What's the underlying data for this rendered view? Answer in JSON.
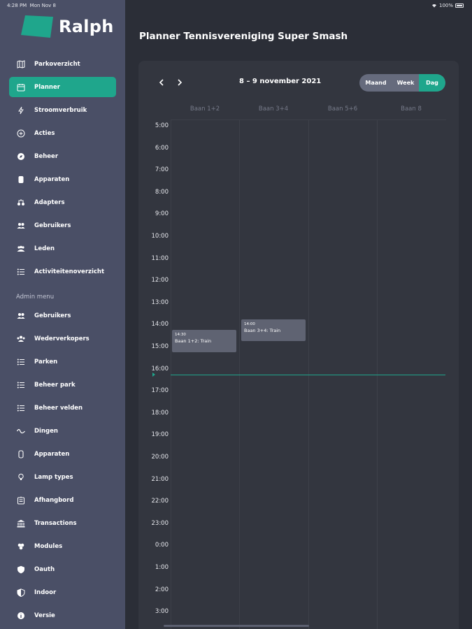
{
  "status": {
    "time": "4:28 PM",
    "date": "Mon Nov 8",
    "battery": "100%"
  },
  "app": {
    "name": "Ralph",
    "accent": "#1fa68c"
  },
  "sidebar": {
    "items": [
      {
        "label": "Parkoverzicht",
        "icon": "map-icon"
      },
      {
        "label": "Planner",
        "icon": "calendar-icon",
        "active": true
      },
      {
        "label": "Stroomverbruik",
        "icon": "power-icon"
      },
      {
        "label": "Acties",
        "icon": "plus-circle-icon"
      },
      {
        "label": "Beheer",
        "icon": "compass-icon"
      },
      {
        "label": "Apparaten",
        "icon": "device-icon"
      },
      {
        "label": "Adapters",
        "icon": "adapter-icon"
      },
      {
        "label": "Gebruikers",
        "icon": "users-icon"
      },
      {
        "label": "Leden",
        "icon": "members-icon"
      },
      {
        "label": "Activiteitenoverzicht",
        "icon": "list-icon"
      }
    ],
    "admin_label": "Admin menu",
    "admin_items": [
      {
        "label": "Gebruikers",
        "icon": "users-icon"
      },
      {
        "label": "Wederverkopers",
        "icon": "resellers-icon"
      },
      {
        "label": "Parken",
        "icon": "list-icon"
      },
      {
        "label": "Beheer park",
        "icon": "list-icon"
      },
      {
        "label": "Beheer velden",
        "icon": "list-icon"
      },
      {
        "label": "Dingen",
        "icon": "wave-icon"
      },
      {
        "label": "Apparaten",
        "icon": "device-outline-icon"
      },
      {
        "label": "Lamp types",
        "icon": "bulb-icon"
      },
      {
        "label": "Afhangbord",
        "icon": "board-icon"
      },
      {
        "label": "Transactions",
        "icon": "bank-icon"
      },
      {
        "label": "Modules",
        "icon": "modules-icon"
      },
      {
        "label": "Oauth",
        "icon": "shield-icon"
      },
      {
        "label": "Indoor",
        "icon": "shield-half-icon"
      },
      {
        "label": "Versie",
        "icon": "info-icon"
      }
    ]
  },
  "main": {
    "title": "Planner Tennisvereniging Super Smash"
  },
  "planner": {
    "date_range": "8 – 9 november 2021",
    "views": [
      "Maand",
      "Week",
      "Dag"
    ],
    "selected_view": "Dag",
    "columns": [
      "Baan 1+2",
      "Baan 3+4",
      "Baan 5+6",
      "Baan 8"
    ],
    "hours": [
      "5:00",
      "6:00",
      "7:00",
      "8:00",
      "9:00",
      "10:00",
      "11:00",
      "12:00",
      "13:00",
      "14:00",
      "15:00",
      "16:00",
      "17:00",
      "18:00",
      "19:00",
      "20:00",
      "21:00",
      "22:00",
      "23:00",
      "0:00",
      "1:00",
      "2:00",
      "3:00"
    ],
    "events": [
      {
        "column": 0,
        "time": "14:30",
        "title": "Baan 1+2: Train",
        "start": 14.25,
        "end": 15.25
      },
      {
        "column": 1,
        "time": "14:00",
        "title": "Baan 3+4: Train",
        "start": 13.75,
        "end": 14.75
      }
    ],
    "now_hour": 16.25
  }
}
